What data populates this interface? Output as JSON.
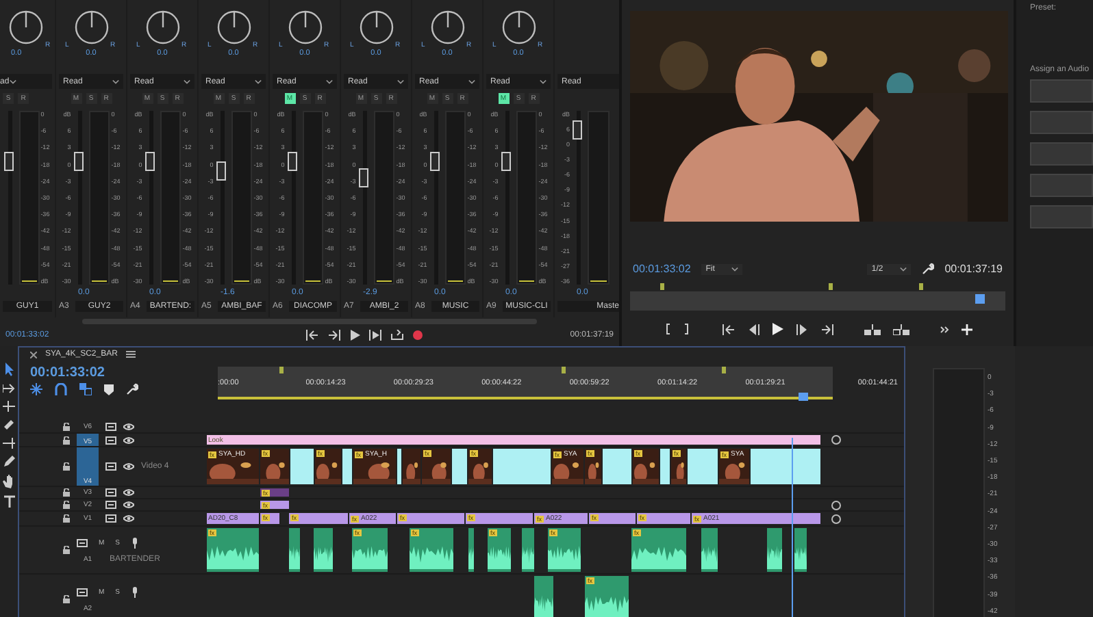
{
  "mixer": {
    "channels": [
      {
        "pan_right": "R",
        "pan_value": "0.0",
        "automation": "ad",
        "buttons": [
          {
            "label": "S",
            "on": false
          },
          {
            "label": "R",
            "on": false
          }
        ],
        "level": 0.72,
        "meter_scale": [
          "0",
          "-6",
          "-12",
          "-18",
          "-24",
          "-30",
          "-36",
          "-42",
          "-48",
          "-54",
          "dB"
        ],
        "name": "GUY1"
      },
      {
        "pan_left": "L",
        "pan_right": "R",
        "pan_value": "0.0",
        "automation": "Read",
        "buttons": [
          {
            "label": "M",
            "on": false
          },
          {
            "label": "S",
            "on": false
          },
          {
            "label": "R",
            "on": false
          }
        ],
        "level": 0.72,
        "fader_scale": [
          "dB",
          "6",
          "3",
          "0",
          "-3",
          "-6",
          "-9",
          "-12",
          "-15",
          "-21",
          "-30"
        ],
        "meter_scale": [
          "0",
          "-6",
          "-12",
          "-18",
          "-24",
          "-30",
          "-36",
          "-42",
          "-48",
          "-54",
          "dB"
        ],
        "volume": "0.0",
        "track": "A3",
        "name": "GUY2"
      },
      {
        "pan_left": "L",
        "pan_right": "R",
        "pan_value": "0.0",
        "automation": "Read",
        "buttons": [
          {
            "label": "M",
            "on": false
          },
          {
            "label": "S",
            "on": false
          },
          {
            "label": "R",
            "on": false
          }
        ],
        "level": 0.72,
        "fader_scale": [
          "dB",
          "6",
          "3",
          "0",
          "-3",
          "-6",
          "-9",
          "-12",
          "-15",
          "-21",
          "-30"
        ],
        "meter_scale": [
          "0",
          "-6",
          "-12",
          "-18",
          "-24",
          "-30",
          "-36",
          "-42",
          "-48",
          "-54",
          "dB"
        ],
        "volume": "0.0",
        "track": "A4",
        "name": "BARTEND:"
      },
      {
        "pan_left": "L",
        "pan_right": "R",
        "pan_value": "0.0",
        "automation": "Read",
        "buttons": [
          {
            "label": "M",
            "on": false
          },
          {
            "label": "S",
            "on": false
          },
          {
            "label": "R",
            "on": false
          }
        ],
        "level": 0.66,
        "fader_scale": [
          "dB",
          "6",
          "3",
          "0",
          "-3",
          "-6",
          "-9",
          "-12",
          "-15",
          "-21",
          "-30"
        ],
        "meter_scale": [
          "0",
          "-6",
          "-12",
          "-18",
          "-24",
          "-30",
          "-36",
          "-42",
          "-48",
          "-54",
          "dB"
        ],
        "volume": "-1.6",
        "track": "A5",
        "name": "AMBI_BAF"
      },
      {
        "pan_left": "L",
        "pan_right": "R",
        "pan_value": "0.0",
        "automation": "Read",
        "buttons": [
          {
            "label": "M",
            "on": true
          },
          {
            "label": "S",
            "on": false
          },
          {
            "label": "R",
            "on": false
          }
        ],
        "level": 0.72,
        "fader_scale": [
          "dB",
          "6",
          "3",
          "0",
          "-3",
          "-6",
          "-9",
          "-12",
          "-15",
          "-21",
          "-30"
        ],
        "meter_scale": [
          "0",
          "-6",
          "-12",
          "-18",
          "-24",
          "-30",
          "-36",
          "-42",
          "-48",
          "-54",
          "dB"
        ],
        "volume": "0.0",
        "track": "A6",
        "name": "DIACOMP"
      },
      {
        "pan_left": "L",
        "pan_right": "R",
        "pan_value": "0.0",
        "automation": "Read",
        "buttons": [
          {
            "label": "M",
            "on": false
          },
          {
            "label": "S",
            "on": false
          },
          {
            "label": "R",
            "on": false
          }
        ],
        "level": 0.62,
        "fader_scale": [
          "dB",
          "6",
          "3",
          "0",
          "-3",
          "-6",
          "-9",
          "-12",
          "-15",
          "-21",
          "-30"
        ],
        "meter_scale": [
          "0",
          "-6",
          "-12",
          "-18",
          "-24",
          "-30",
          "-36",
          "-42",
          "-48",
          "-54",
          "dB"
        ],
        "volume": "-2.9",
        "track": "A7",
        "name": "AMBI_2"
      },
      {
        "pan_left": "L",
        "pan_right": "R",
        "pan_value": "0.0",
        "automation": "Read",
        "buttons": [
          {
            "label": "M",
            "on": false
          },
          {
            "label": "S",
            "on": false
          },
          {
            "label": "R",
            "on": false
          }
        ],
        "level": 0.72,
        "fader_scale": [
          "dB",
          "6",
          "3",
          "0",
          "-3",
          "-6",
          "-9",
          "-12",
          "-15",
          "-21",
          "-30"
        ],
        "meter_scale": [
          "0",
          "-6",
          "-12",
          "-18",
          "-24",
          "-30",
          "-36",
          "-42",
          "-48",
          "-54",
          "dB"
        ],
        "volume": "0.0",
        "track": "A8",
        "name": "MUSIC"
      },
      {
        "pan_left": "L",
        "pan_right": "R",
        "pan_value": "0.0",
        "automation": "Read",
        "buttons": [
          {
            "label": "M",
            "on": true
          },
          {
            "label": "S",
            "on": false
          },
          {
            "label": "R",
            "on": false
          }
        ],
        "level": 0.72,
        "fader_scale": [
          "dB",
          "6",
          "3",
          "0",
          "-3",
          "-6",
          "-9",
          "-12",
          "-15",
          "-21",
          "-30"
        ],
        "meter_scale": [
          "0",
          "-6",
          "-12",
          "-18",
          "-24",
          "-30",
          "-36",
          "-42",
          "-48",
          "-54",
          "dB"
        ],
        "volume": "0.0",
        "track": "A9",
        "name": "MUSIC-CLI"
      },
      {
        "automation": "Read",
        "level": 0.9,
        "fader_scale": [
          "dB",
          "6",
          "0",
          "-3",
          "-6",
          "-9",
          "-12",
          "-15",
          "-18",
          "-21",
          "-27",
          "-36"
        ],
        "volume": "0.0",
        "name": "Maste"
      }
    ],
    "timecode": "00:01:33:02",
    "duration": "00:01:37:19"
  },
  "program_monitor": {
    "timecode": "00:01:33:02",
    "zoom": "Fit",
    "resolution": "1/2",
    "duration": "00:01:37:19",
    "level": 0.93
  },
  "side_panel": {
    "preset_label": "Preset:",
    "assign_label": "Assign an Audio"
  },
  "timeline": {
    "sequence_tab": "SYA_4K_SC2_BAR",
    "timecode": "00:01:33:02",
    "level": 0.95,
    "ruler": [
      ":00:00",
      "00:00:14:23",
      "00:00:29:23",
      "00:00:44:22",
      "00:00:59:22",
      "00:01:14:22",
      "00:01:29:21",
      "00:01:44:21"
    ],
    "tracks": [
      {
        "id": "V6",
        "kind": "video",
        "selected": false
      },
      {
        "id": "V5",
        "kind": "video",
        "selected": true,
        "clips": [
          {
            "kind": "adjustment",
            "label": "Look"
          }
        ]
      },
      {
        "id": "V4",
        "kind": "video",
        "selected": true,
        "name": "Video 4",
        "clips": [
          {
            "kind": "thumb",
            "badge": "fx",
            "label": "SYA_HD"
          },
          {
            "kind": "thumb",
            "badge": "fx"
          },
          {
            "kind": "plain"
          },
          {
            "kind": "thumb",
            "badge": "fx"
          },
          {
            "kind": "plain"
          },
          {
            "kind": "thumb",
            "badge": "fx",
            "label": "SYA_H"
          },
          {
            "kind": "plain"
          },
          {
            "kind": "thumb"
          },
          {
            "kind": "thumb",
            "badge": "fx"
          },
          {
            "kind": "plain"
          },
          {
            "kind": "thumb",
            "badge": "fx"
          },
          {
            "kind": "plain"
          },
          {
            "kind": "thumb",
            "badge": "fx",
            "label": "SYA"
          },
          {
            "kind": "thumb",
            "badge": "fx"
          },
          {
            "kind": "plain"
          },
          {
            "kind": "thumb",
            "badge": "fx"
          },
          {
            "kind": "plain"
          },
          {
            "kind": "thumb",
            "badge": "fx"
          },
          {
            "kind": "plain"
          },
          {
            "kind": "thumb",
            "badge": "fx",
            "label": "SYA"
          },
          {
            "kind": "plain"
          }
        ]
      },
      {
        "id": "V3",
        "kind": "video",
        "selected": false,
        "clips": [
          {
            "kind": "nested",
            "badge": "fx"
          }
        ]
      },
      {
        "id": "V2",
        "kind": "video",
        "selected": false,
        "clips": [
          {
            "kind": "graphic",
            "badge": "fx"
          }
        ]
      },
      {
        "id": "V1",
        "kind": "video",
        "selected": false,
        "clips": [
          {
            "kind": "graphic",
            "label": "AD20_C8"
          },
          {
            "kind": "graphic",
            "badge": "fx"
          },
          {
            "kind": "graphic",
            "badge": "fx"
          },
          {
            "kind": "graphic",
            "badge": "fx",
            "label": "A022"
          },
          {
            "kind": "graphic",
            "badge": "fx"
          },
          {
            "kind": "graphic",
            "badge": "fx"
          },
          {
            "kind": "graphic",
            "badge": "fx",
            "label": "A022"
          },
          {
            "kind": "graphic",
            "badge": "fx"
          },
          {
            "kind": "graphic",
            "badge": "fx"
          },
          {
            "kind": "graphic",
            "badge": "fx",
            "label": "A021"
          }
        ]
      },
      {
        "id": "A1",
        "kind": "audio",
        "selected": false,
        "name": "BARTENDER",
        "buttons": [
          "M",
          "S"
        ],
        "clips": [
          {
            "kind": "audio",
            "badge": "fx"
          },
          {
            "kind": "audio"
          },
          {
            "kind": "audio"
          },
          {
            "kind": "audio",
            "badge": "fx"
          },
          {
            "kind": "audio",
            "badge": "fx"
          },
          {
            "kind": "audio"
          },
          {
            "kind": "audio",
            "badge": "fx"
          },
          {
            "kind": "audio"
          },
          {
            "kind": "audio",
            "badge": "fx"
          },
          {
            "kind": "audio",
            "badge": "fx"
          },
          {
            "kind": "audio"
          },
          {
            "kind": "audio"
          },
          {
            "kind": "audio"
          }
        ]
      },
      {
        "id": "A2",
        "kind": "audio",
        "selected": false,
        "buttons": [
          "M",
          "S"
        ],
        "clips": [
          {
            "kind": "audio"
          },
          {
            "kind": "audio",
            "badge": "fx"
          }
        ]
      }
    ]
  },
  "meter": {
    "scale": [
      "0",
      "-3",
      "-6",
      "-9",
      "-12",
      "-15",
      "-18",
      "-21",
      "-24",
      "-27",
      "-30",
      "-33",
      "-36",
      "-39",
      "-42"
    ]
  }
}
